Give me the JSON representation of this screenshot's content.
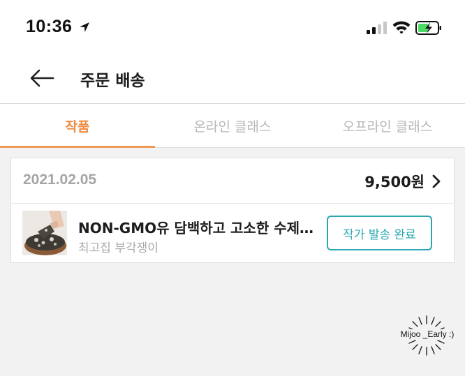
{
  "status_bar": {
    "time": "10:36",
    "icons": [
      "location-arrow-icon",
      "cellular-signal-icon",
      "wifi-icon",
      "battery-charging-icon"
    ],
    "battery_color": "#4cd964"
  },
  "header": {
    "title": "주문 배송",
    "back_icon": "arrow-left-icon"
  },
  "tabs": [
    {
      "label": "작품",
      "active": true
    },
    {
      "label": "온라인 클래스",
      "active": false
    },
    {
      "label": "오프라인 클래스",
      "active": false
    }
  ],
  "colors": {
    "accent_orange": "#ee8a3e",
    "accent_teal": "#2aa7b1"
  },
  "order": {
    "date": "2021.02.05",
    "price": "9,500원",
    "item": {
      "name": "NON-GMO유 담백하고 고소한 수제…",
      "subtitle": "최고집 부각쟁이",
      "status_label": "작가 발송 완료"
    }
  },
  "watermark": {
    "text": "Mijoo _Early :)"
  }
}
